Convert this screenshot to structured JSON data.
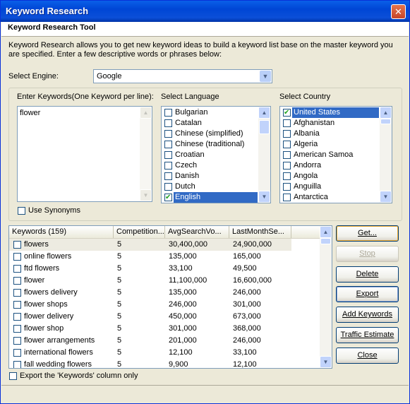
{
  "window": {
    "title": "Keyword Research"
  },
  "header": {
    "title": "Keyword Research Tool"
  },
  "description": "Keyword Research allows you to get new keyword ideas to build a keyword list base on the master keyword you are specified. Enter a few descriptive words or phrases below:",
  "engine": {
    "label": "Select Engine:",
    "value": "Google"
  },
  "keywords_input": {
    "label": "Enter Keywords(One Keyword per line):",
    "value": "flower"
  },
  "language": {
    "label": "Select Language",
    "items": [
      {
        "label": "Bulgarian",
        "checked": false
      },
      {
        "label": "Catalan",
        "checked": false
      },
      {
        "label": "Chinese (simplified)",
        "checked": false
      },
      {
        "label": "Chinese (traditional)",
        "checked": false
      },
      {
        "label": "Croatian",
        "checked": false
      },
      {
        "label": "Czech",
        "checked": false
      },
      {
        "label": "Danish",
        "checked": false
      },
      {
        "label": "Dutch",
        "checked": false
      },
      {
        "label": "English",
        "checked": true,
        "selected": true
      }
    ]
  },
  "country": {
    "label": "Select Country",
    "items": [
      {
        "label": "United States",
        "checked": true,
        "selected": true
      },
      {
        "label": "Afghanistan",
        "checked": false
      },
      {
        "label": "Albania",
        "checked": false
      },
      {
        "label": "Algeria",
        "checked": false
      },
      {
        "label": "American Samoa",
        "checked": false
      },
      {
        "label": "Andorra",
        "checked": false
      },
      {
        "label": "Angola",
        "checked": false
      },
      {
        "label": "Anguilla",
        "checked": false
      },
      {
        "label": "Antarctica",
        "checked": false
      }
    ]
  },
  "use_synonyms": {
    "label": "Use Synonyms",
    "checked": false
  },
  "table": {
    "columns": [
      "Keywords (159)",
      "Competition...",
      "AvgSearchVo...",
      "LastMonthSe..."
    ],
    "rows": [
      {
        "keyword": "flowers",
        "competition": "5",
        "avg": "30,400,000",
        "last": "24,900,000"
      },
      {
        "keyword": "online flowers",
        "competition": "5",
        "avg": "135,000",
        "last": "165,000"
      },
      {
        "keyword": "ftd flowers",
        "competition": "5",
        "avg": "33,100",
        "last": "49,500"
      },
      {
        "keyword": "flower",
        "competition": "5",
        "avg": "11,100,000",
        "last": "16,600,000"
      },
      {
        "keyword": "flowers delivery",
        "competition": "5",
        "avg": "135,000",
        "last": "246,000"
      },
      {
        "keyword": "flower shops",
        "competition": "5",
        "avg": "246,000",
        "last": "301,000"
      },
      {
        "keyword": "flower delivery",
        "competition": "5",
        "avg": "450,000",
        "last": "673,000"
      },
      {
        "keyword": "flower shop",
        "competition": "5",
        "avg": "301,000",
        "last": "368,000"
      },
      {
        "keyword": "flower arrangements",
        "competition": "5",
        "avg": "201,000",
        "last": "246,000"
      },
      {
        "keyword": "international flowers",
        "competition": "5",
        "avg": "12,100",
        "last": "33,100"
      },
      {
        "keyword": "fall wedding flowers",
        "competition": "5",
        "avg": "9,900",
        "last": "12,100"
      }
    ]
  },
  "buttons": {
    "get": "Get...",
    "stop": "Stop",
    "delete": "Delete",
    "export": "Export",
    "add_keywords": "Add Keywords",
    "traffic_estimate": "Traffic Estimate",
    "close": "Close"
  },
  "export_option": {
    "label": "Export the 'Keywords' column only",
    "checked": false
  },
  "colors": {
    "titlebar": "#0054E3",
    "selection": "#316AC5",
    "face": "#ECE9D8"
  }
}
